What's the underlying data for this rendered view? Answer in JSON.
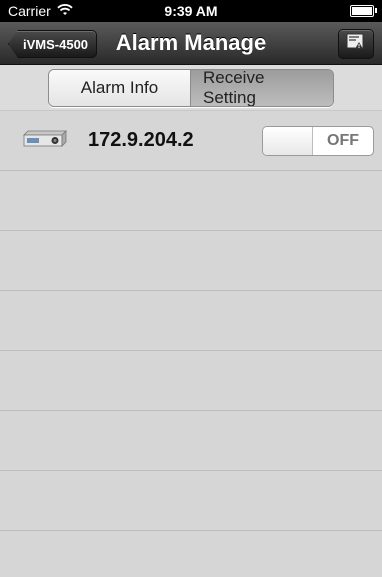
{
  "statusbar": {
    "carrier": "Carrier",
    "time": "9:39 AM",
    "wifi_icon": "wifi-icon",
    "battery_icon": "battery-icon"
  },
  "navbar": {
    "back_label": "iVMS-4500",
    "title": "Alarm Manage",
    "right_icon": "alarm-settings-icon"
  },
  "tabs": {
    "alarm_info": "Alarm Info",
    "receive_setting": "Receive Setting",
    "selected": "receive_setting"
  },
  "devices": [
    {
      "ip": "172.9.204.2",
      "icon": "dvr-device-icon",
      "toggle_state": "OFF"
    }
  ],
  "colors": {
    "navbar_top": "#5a5a5a",
    "navbar_bottom": "#2a2a2a",
    "background": "#d6d6d6"
  }
}
